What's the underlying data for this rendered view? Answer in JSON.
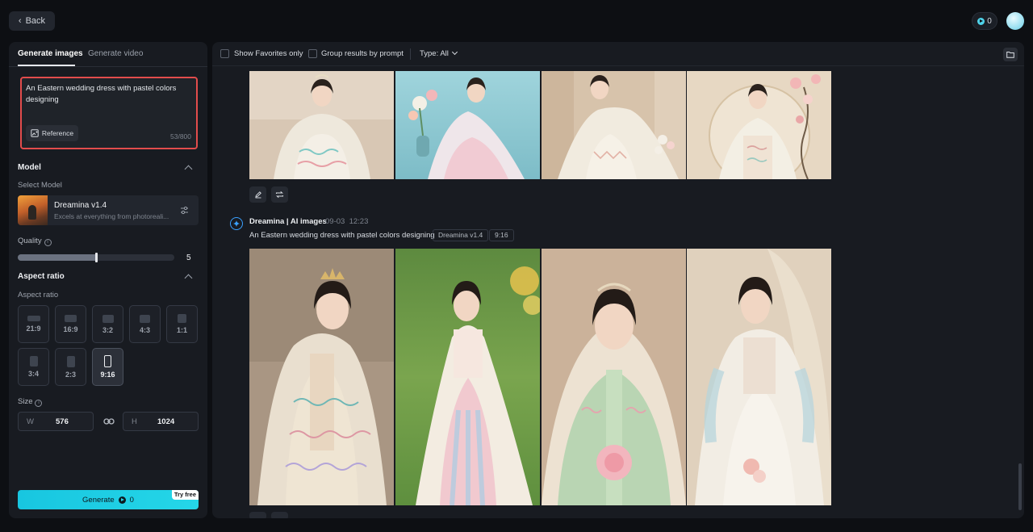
{
  "header": {
    "back_label": "Back",
    "credits": "0"
  },
  "left_panel": {
    "tabs": [
      {
        "label": "Generate images",
        "active": true
      },
      {
        "label": "Generate video",
        "active": false
      }
    ],
    "prompt": {
      "text": "An Eastern wedding dress with pastel colors designing",
      "reference_label": "Reference",
      "counter": "53/800"
    },
    "model": {
      "section_title": "Model",
      "select_label": "Select Model",
      "name": "Dreamina v1.4",
      "description": "Excels at everything from photoreali..."
    },
    "quality": {
      "label": "Quality",
      "value": "5",
      "fill_fraction": 0.5
    },
    "aspect_ratio": {
      "section_title": "Aspect ratio",
      "sub_label": "Aspect ratio",
      "options": [
        "21:9",
        "16:9",
        "3:2",
        "4:3",
        "1:1",
        "3:4",
        "2:3",
        "9:16"
      ],
      "selected": "9:16"
    },
    "size": {
      "label": "Size",
      "width_label": "W",
      "width": "576",
      "height_label": "H",
      "height": "1024"
    },
    "generate": {
      "label": "Generate",
      "cost": "0",
      "badge": "Try free"
    }
  },
  "toolbar": {
    "favorites_label": "Show Favorites only",
    "group_label": "Group results by prompt",
    "type_label": "Type: All"
  },
  "results": {
    "second_generation": {
      "title": "Dreamina | AI images",
      "date": "09-03",
      "time": "12:23",
      "prompt": "An Eastern wedding dress with pastel colors designing",
      "model_tag": "Dreamina v1.4",
      "ratio_tag": "9:16"
    }
  },
  "colors": {
    "accent": "#25d6e8",
    "highlight_border": "#e24c4c",
    "panel_bg": "#181b21",
    "page_bg": "#0d0f13"
  }
}
